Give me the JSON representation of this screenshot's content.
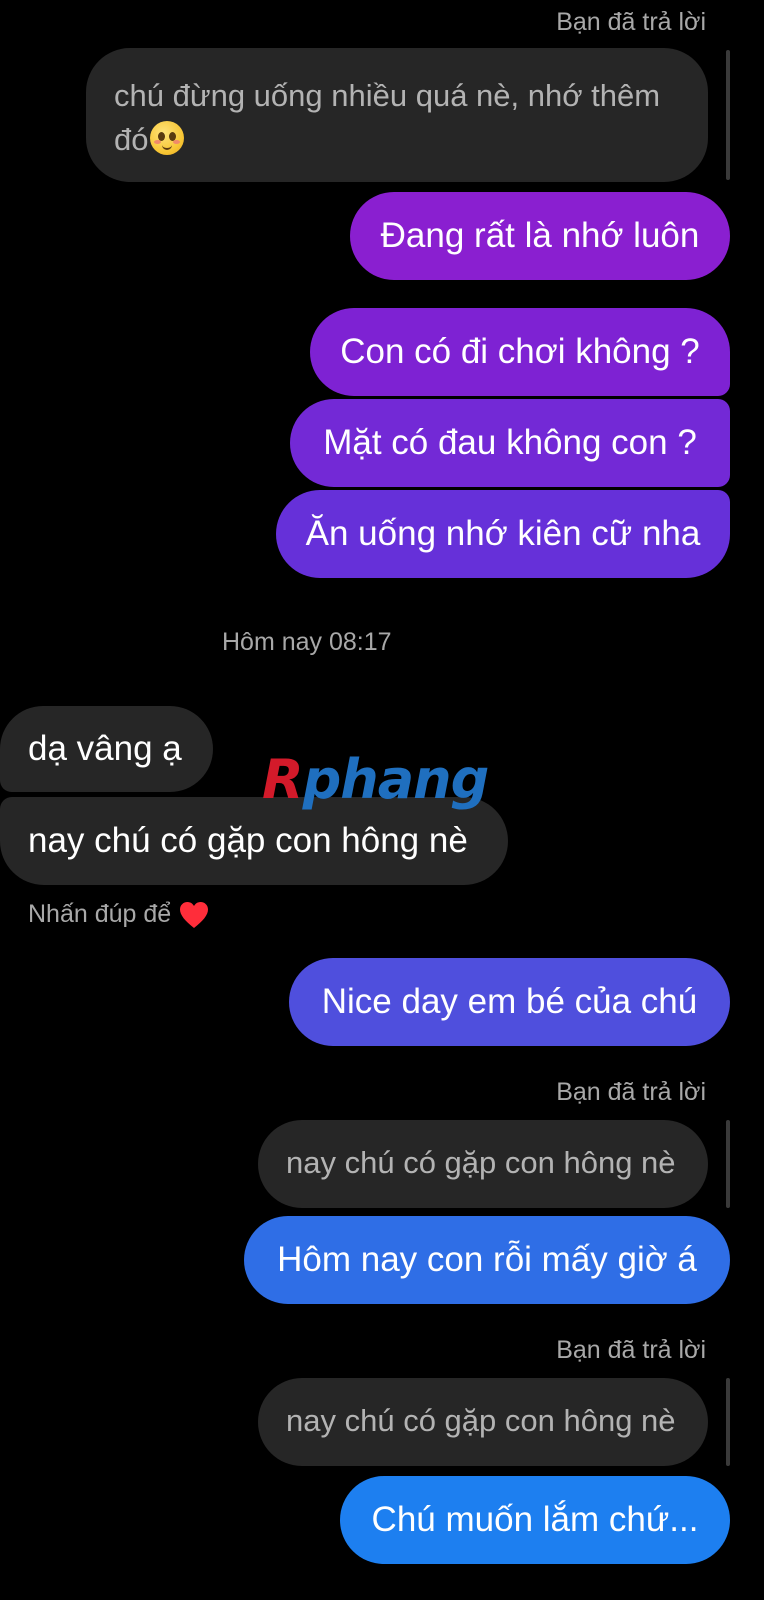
{
  "conversation": {
    "reply_label_1": "Bạn đã trả lời",
    "quoted_1_line1": "chú đừng uống nhiều quá nè, nhớ thêm",
    "quoted_1_line2": "đó",
    "quoted_1_emoji": "smiling-face-emoji",
    "msg_out_1": "Đang rất là nhớ luôn",
    "msg_out_2": "Con có đi chơi không ?",
    "msg_out_3": "Mặt có đau không con ?",
    "msg_out_4": "Ăn uống nhớ kiên cữ nha",
    "timestamp": "Hôm nay 08:17",
    "msg_in_1": "dạ vâng ạ",
    "msg_in_2": "nay chú có gặp con hông nè",
    "double_tap_hint": "Nhấn đúp để",
    "heart_icon": "red-heart",
    "msg_out_5": "Nice day em bé của chú",
    "reply_label_2": "Bạn đã trả lời",
    "quoted_2": "nay chú có gặp con hông nè",
    "msg_out_6": "Hôm nay con rỗi mấy giờ á",
    "reply_label_3": "Bạn đã trả lời",
    "quoted_3": "nay chú có gặp con hông nè",
    "msg_out_7": "Chú muốn lắm chứ..."
  },
  "watermark": {
    "letter_r": "R",
    "rest": "phang"
  },
  "colors": {
    "background": "#000000",
    "incoming_bubble": "#262626",
    "purple_1": "#8a1fd0",
    "purple_2": "#7a2ad6",
    "violet": "#5b45dc",
    "blue": "#2e6fe6",
    "meta_text": "#a8a8a8"
  }
}
